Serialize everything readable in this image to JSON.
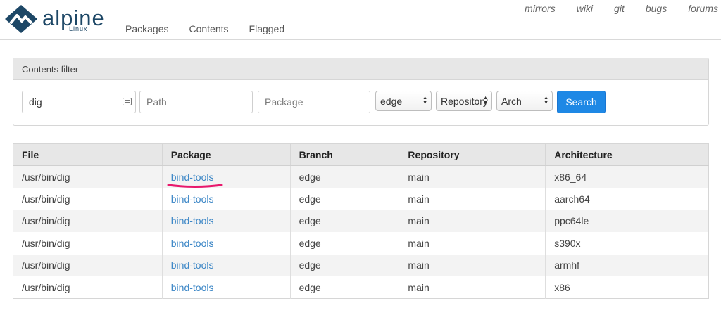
{
  "brand": {
    "name": "alpine",
    "sub": "Linux",
    "logo_color": "#1d4766"
  },
  "nav": {
    "items": [
      "Packages",
      "Contents",
      "Flagged"
    ]
  },
  "util_nav": {
    "items": [
      "mirrors",
      "wiki",
      "git",
      "bugs",
      "forums"
    ]
  },
  "filter": {
    "title": "Contents filter",
    "name_value": "dig",
    "path_placeholder": "Path",
    "package_placeholder": "Package",
    "branch_selected": "edge",
    "repository_selected": "Repository",
    "arch_selected": "Arch",
    "search_label": "Search",
    "search_color": "#1e88e5"
  },
  "table": {
    "headers": [
      "File",
      "Package",
      "Branch",
      "Repository",
      "Architecture"
    ],
    "rows": [
      {
        "file": "/usr/bin/dig",
        "package": "bind-tools",
        "branch": "edge",
        "repository": "main",
        "arch": "x86_64"
      },
      {
        "file": "/usr/bin/dig",
        "package": "bind-tools",
        "branch": "edge",
        "repository": "main",
        "arch": "aarch64"
      },
      {
        "file": "/usr/bin/dig",
        "package": "bind-tools",
        "branch": "edge",
        "repository": "main",
        "arch": "ppc64le"
      },
      {
        "file": "/usr/bin/dig",
        "package": "bind-tools",
        "branch": "edge",
        "repository": "main",
        "arch": "s390x"
      },
      {
        "file": "/usr/bin/dig",
        "package": "bind-tools",
        "branch": "edge",
        "repository": "main",
        "arch": "armhf"
      },
      {
        "file": "/usr/bin/dig",
        "package": "bind-tools",
        "branch": "edge",
        "repository": "main",
        "arch": "x86"
      }
    ],
    "link_color": "#3b86c6",
    "highlight_color": "#e8186c"
  }
}
